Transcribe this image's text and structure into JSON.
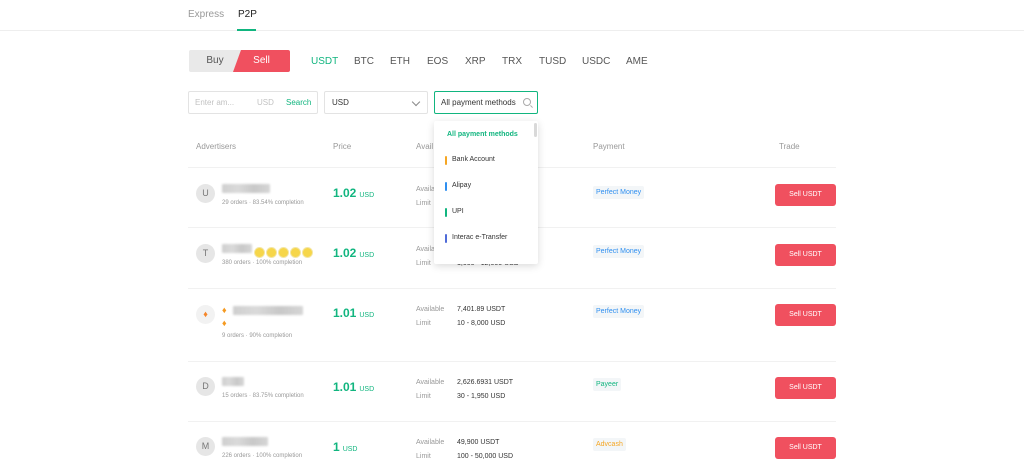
{
  "tabs": [
    {
      "label": "Express",
      "active": false
    },
    {
      "label": "P2P",
      "active": true
    }
  ],
  "mode": {
    "buy_label": "Buy",
    "sell_label": "Sell",
    "selected": "Sell"
  },
  "coins": [
    "USDT",
    "BTC",
    "ETH",
    "EOS",
    "XRP",
    "TRX",
    "TUSD",
    "USDC",
    "AME"
  ],
  "active_coin": "USDT",
  "filters": {
    "amount_placeholder": "Enter am...",
    "amount_currency": "USD",
    "search_label": "Search",
    "currency_value": "USD",
    "payment_value": "All payment methods"
  },
  "table_headers": {
    "advertisers": "Advertisers",
    "price": "Price",
    "available": "Avail",
    "payment": "Payment",
    "trade": "Trade"
  },
  "labels": {
    "available": "Available",
    "limit": "Limit"
  },
  "rows": [
    {
      "avatar": "U",
      "orders": "29 orders · 83.54% completion",
      "price": "1.02",
      "currency": "USD",
      "available": "",
      "limit": "",
      "payment": "Perfect Money",
      "trade": "Sell USDT"
    },
    {
      "avatar": "T",
      "orders": "380 orders · 100% completion",
      "price": "1.02",
      "currency": "USD",
      "available": "",
      "limit": "1,000 - 12,000 USD",
      "payment": "Perfect Money",
      "trade": "Sell USDT"
    },
    {
      "avatar": "",
      "orders": "9 orders · 90% completion",
      "price": "1.01",
      "currency": "USD",
      "available": "7,401.89 USDT",
      "limit": "10 - 8,000 USD",
      "payment": "Perfect Money",
      "trade": "Sell USDT"
    },
    {
      "avatar": "D",
      "orders": "15 orders · 83.75% completion",
      "price": "1.01",
      "currency": "USD",
      "available": "2,626.6931 USDT",
      "limit": "30 - 1,950 USD",
      "payment": "Payeer",
      "trade": "Sell USDT"
    },
    {
      "avatar": "M",
      "orders": "226 orders · 100% completion",
      "price": "1",
      "currency": "USD",
      "available": "49,900 USDT",
      "limit": "100 - 50,000 USD",
      "payment": "Advcash",
      "trade": "Sell USDT"
    }
  ],
  "payment_dropdown": {
    "header": "All payment methods",
    "items": [
      {
        "label": "Bank Account",
        "color": "#f5a623"
      },
      {
        "label": "Alipay",
        "color": "#2f8ff0"
      },
      {
        "label": "UPI",
        "color": "#11b57f"
      },
      {
        "label": "Interac e-Transfer",
        "color": "#4f6bd8"
      }
    ]
  },
  "colors": {
    "accent_green": "#11b57f",
    "sell_red": "#f0505f",
    "payeer_green": "#11b57f",
    "perfect_money_blue": "#2f8ff0",
    "advcash_orange": "#f5a623"
  },
  "icons": {
    "currency_chevron": "chevron-down-icon",
    "payment_search": "search-icon",
    "flame": "flame-icon",
    "star": "star-icon"
  }
}
